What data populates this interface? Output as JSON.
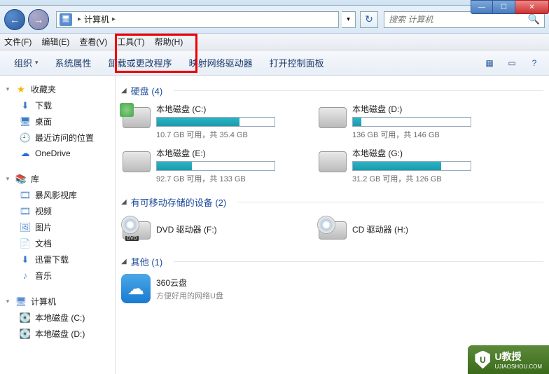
{
  "titlebar": {
    "min": "—",
    "max": "☐",
    "close": "✕"
  },
  "nav": {
    "back": "←",
    "fwd": "→",
    "breadcrumb_icon": "🖥",
    "breadcrumb": "计算机",
    "arrow": "▸",
    "dropdown": "▾",
    "refresh": "↻",
    "search_placeholder": "搜索 计算机",
    "search_icon": "🔍"
  },
  "menu": {
    "file": "文件(F)",
    "edit": "编辑(E)",
    "view": "查看(V)",
    "tools": "工具(T)",
    "help": "帮助(H)"
  },
  "toolbar": {
    "organize": "组织",
    "properties": "系统属性",
    "uninstall": "卸载或更改程序",
    "map_drive": "映射网络驱动器",
    "control_panel": "打开控制面板",
    "view_icon": "▦",
    "pane_icon": "▭",
    "help_icon": "?"
  },
  "sidebar": {
    "favorites": "收藏夹",
    "downloads": "下载",
    "desktop": "桌面",
    "recent": "最近访问的位置",
    "onedrive": "OneDrive",
    "libraries": "库",
    "baofeng": "暴风影视库",
    "videos": "视频",
    "pictures": "图片",
    "documents": "文档",
    "xunlei": "迅雷下载",
    "music": "音乐",
    "computer": "计算机",
    "drive_c": "本地磁盘 (C:)",
    "drive_d": "本地磁盘 (D:)"
  },
  "content": {
    "hdd_header": "硬盘 (4)",
    "removable_header": "有可移动存储的设备 (2)",
    "other_header": "其他 (1)",
    "drives": [
      {
        "name": "本地磁盘 (C:)",
        "stats": "10.7 GB 可用，共 35.4 GB",
        "fill": 70,
        "c": true
      },
      {
        "name": "本地磁盘 (D:)",
        "stats": "136 GB 可用，共 146 GB",
        "fill": 7,
        "c": false
      },
      {
        "name": "本地磁盘 (E:)",
        "stats": "92.7 GB 可用，共 133 GB",
        "fill": 30,
        "c": false
      },
      {
        "name": "本地磁盘 (G:)",
        "stats": "31.2 GB 可用，共 126 GB",
        "fill": 75,
        "c": false
      }
    ],
    "removable": [
      {
        "name": "DVD 驱动器 (F:)",
        "label": "DVD"
      },
      {
        "name": "CD 驱动器 (H:)",
        "label": ""
      }
    ],
    "other": {
      "name": "360云盘",
      "desc": "方便好用的网络U盘",
      "icon": "☁"
    }
  },
  "watermark": {
    "shield": "U",
    "title": "U教授",
    "sub": "UJIAOSHOU.COM"
  }
}
